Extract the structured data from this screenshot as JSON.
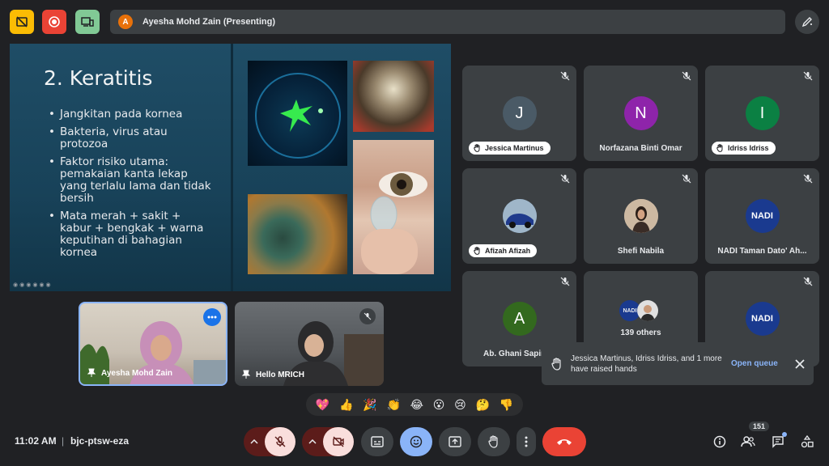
{
  "header": {
    "presenter_initial": "A",
    "presenter_label": "Ayesha Mohd Zain (Presenting)"
  },
  "slide": {
    "title": "2. Keratitis",
    "bullets": [
      "Jangkitan pada kornea",
      "Bakteria, virus atau protozoa",
      "Faktor risiko utama: pemakaian kanta lekap yang terlalu lama dan tidak bersih",
      "Mata merah + sakit + kabur + bengkak + warna keputihan di bahagian kornea"
    ]
  },
  "participants": [
    {
      "initial": "J",
      "name": "Jessica Martinus",
      "color": "#4a5a66",
      "hand": true
    },
    {
      "initial": "N",
      "name": "Norfazana Binti Omar",
      "color": "#8e24aa",
      "hand": false
    },
    {
      "initial": "I",
      "name": "Idriss Idriss",
      "color": "#0b8043",
      "hand": true
    },
    {
      "name": "Afizah Afizah",
      "hand": true
    },
    {
      "name": "Shefi Nabila",
      "hand": false
    },
    {
      "name": "NADI Taman Dato' Ah...",
      "hand": false
    },
    {
      "initial": "A",
      "name": "Ab. Ghani Sapinah",
      "color": "#33691e",
      "hand": false
    },
    {
      "name": "139 others"
    },
    {
      "name": ""
    }
  ],
  "logo_text": "NADI",
  "videos": {
    "self_name": "Ayesha Mohd Zain",
    "other_name": "Hello MRICH"
  },
  "toast": {
    "message": "Jessica Martinus, Idriss Idriss, and 1 more have raised hands",
    "action": "Open queue"
  },
  "reactions": [
    "💖",
    "👍",
    "🎉",
    "👏",
    "😂",
    "😮",
    "😢",
    "🤔",
    "👎"
  ],
  "footer": {
    "time": "11:02 AM",
    "separator": "|",
    "meeting_code": "bjc-ptsw-eza",
    "people_count": "151"
  },
  "colors": {
    "background": "#202124",
    "tile": "#3c4043",
    "end_call": "#ea4335",
    "accent_blue": "#8ab4f8"
  }
}
